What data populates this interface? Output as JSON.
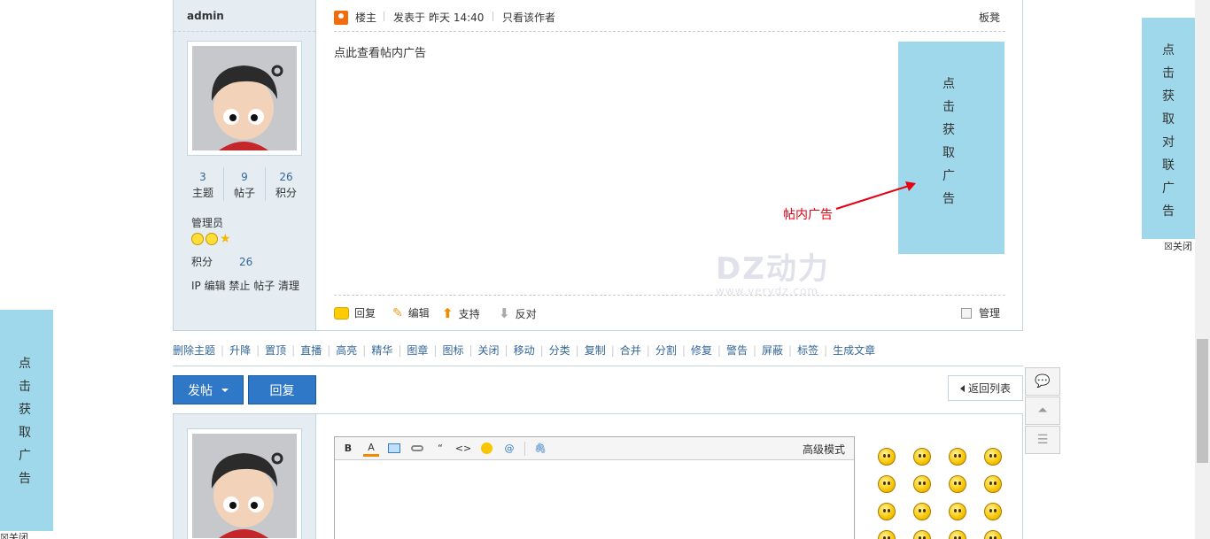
{
  "post": {
    "author": "admin",
    "stats": [
      {
        "num": "3",
        "label": "主题"
      },
      {
        "num": "9",
        "label": "帖子"
      },
      {
        "num": "26",
        "label": "积分"
      }
    ],
    "group": "管理员",
    "credit_label": "积分",
    "credit_value": "26",
    "side_ops": "IP 编辑 禁止 帖子 清理",
    "floor_label": "楼主",
    "posted_prefix": "发表于",
    "posted_time": "昨天 14:40",
    "only_author": "只看该作者",
    "floor_seat": "板凳",
    "content": "点此查看帖内广告",
    "ad_chars": [
      "点",
      "击",
      "获",
      "取",
      "广",
      "告"
    ],
    "ad_annotation": "帖内广告",
    "footer": {
      "reply": "回复",
      "edit": "编辑",
      "support": "支持",
      "oppose": "反对",
      "manage": "管理"
    }
  },
  "watermark": {
    "main": "DZ动力",
    "sub": "www.verydz.com"
  },
  "mod_links": [
    "删除主题",
    "升降",
    "置顶",
    "直播",
    "高亮",
    "精华",
    "图章",
    "图标",
    "关闭",
    "移动",
    "分类",
    "复制",
    "合并",
    "分割",
    "修复",
    "警告",
    "屏蔽",
    "标签",
    "生成文章"
  ],
  "buttons": {
    "new_post": "发帖",
    "reply": "回复",
    "back_list": "返回列表"
  },
  "editor": {
    "toolbar": [
      "B",
      "A",
      "img",
      "link",
      "quote",
      "code",
      "smile",
      "at",
      "attach"
    ],
    "advanced": "高级模式"
  },
  "couplet_right": {
    "chars": [
      "点",
      "击",
      "获",
      "取",
      "对",
      "联",
      "广",
      "告"
    ],
    "close": "关闭"
  },
  "couplet_left": {
    "chars": [
      "点",
      "击",
      "获",
      "取",
      "广",
      "告"
    ],
    "close": "关闭"
  },
  "colors": {
    "accent": "#2f78c8",
    "ad_bg": "#9ed8ea",
    "side_bg": "#e5edf2",
    "link": "#336699"
  }
}
